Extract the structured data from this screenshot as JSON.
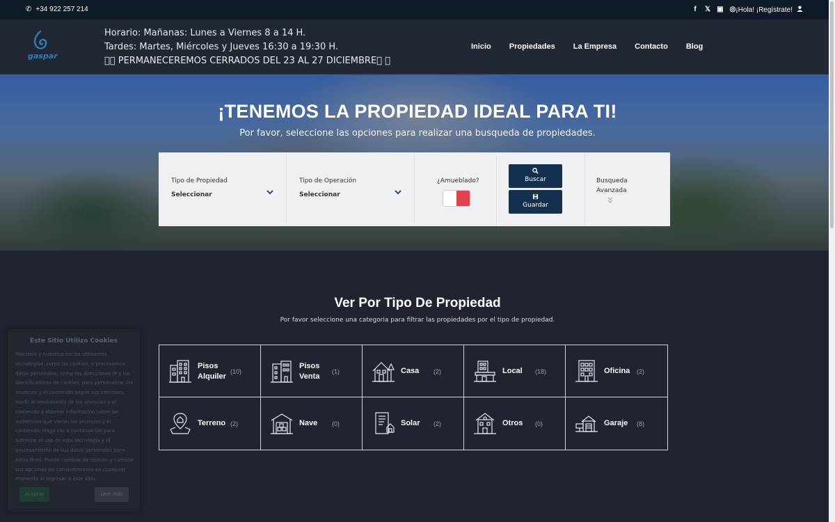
{
  "topbar": {
    "phone": "+34 922 257 214",
    "social": [
      "facebook-icon",
      "x-icon",
      "linkedin-icon",
      "instagram-icon"
    ],
    "register": "¡Hola! ¡Regístrate!"
  },
  "header": {
    "logo_text": "gaspar",
    "schedule": [
      "Horario: Mañanas: Lunes a Viernes 8 a 14 H.",
      "Tardes: Martes, Miércoles y Jueves 16:30 a 19:30 H.",
      "⃝⃝ PERMANECEREMOS CERRADOS DEL 23 AL 27 DICIEMBRE⃝ ⃝"
    ],
    "nav": [
      "Inicio",
      "Propiedades",
      "La Empresa",
      "Contacto",
      "Blog"
    ]
  },
  "hero": {
    "title": "¡TENEMOS LA PROPIEDAD IDEAL PARA TI!",
    "subtitle": "Por favor, seleccione las opciones para realizar una busqueda de propiedades.",
    "search": {
      "type_label": "Tipo de Propiedad",
      "type_value": "Seleccionar",
      "op_label": "Tipo de Operación",
      "op_value": "Seleccionar",
      "furnished_label": "¿Amueblado?",
      "search_btn": "Buscar",
      "save_btn": "Guardar",
      "advanced_line1": "Busqueda",
      "advanced_line2": "Avanzada"
    }
  },
  "section": {
    "title": "Ver Por Tipo De Propiedad",
    "subtitle": "Por favor seleccione una categoria para filtrar las propiedades por el tipo de propiedad.",
    "categories": [
      {
        "line1": "Pisos",
        "line2": "Alquiler",
        "count": "(10)",
        "icon": "apartment-building-icon"
      },
      {
        "line1": "Pisos",
        "line2": "Venta",
        "count": "(1)",
        "icon": "apartment-building-icon"
      },
      {
        "line1": "Casa",
        "line2": "",
        "count": "(2)",
        "icon": "house-icon"
      },
      {
        "line1": "Local",
        "line2": "",
        "count": "(18)",
        "icon": "shop-icon"
      },
      {
        "line1": "Oficina",
        "line2": "",
        "count": "(2)",
        "icon": "office-building-icon"
      },
      {
        "line1": "Terreno",
        "line2": "",
        "count": "(2)",
        "icon": "land-pin-icon"
      },
      {
        "line1": "Nave",
        "line2": "",
        "count": "(0)",
        "icon": "warehouse-icon"
      },
      {
        "line1": "Solar",
        "line2": "",
        "count": "(2)",
        "icon": "plot-document-icon"
      },
      {
        "line1": "Otros",
        "line2": "",
        "count": "(0)",
        "icon": "building-icon"
      },
      {
        "line1": "Garaje",
        "line2": "",
        "count": "(8)",
        "icon": "garage-sale-icon"
      }
    ]
  },
  "cookie": {
    "title": "Este Sitio Utiliza Cookies",
    "text": "Nosotros y nuestros socios utilizamos tecnologías, como las cookies, y procesamos datos personales, como las direcciones IP y los identificadores de cookies, para personalizar los anuncios y el contenido según sus intereses, medir el rendimiento de los anuncios y el contenido y obtener información sobre las audiencias que vieron los anuncios y el contenido. Haga clic a continuación para autorizar el uso de esta tecnología y el procesamiento de sus datos personales para estos fines. Puede cambiar de opinión y cambiar sus opciones de consentimiento en cualquier momento al regresar a este sitio.",
    "accept": "Aceptar",
    "more": "Leer más"
  }
}
